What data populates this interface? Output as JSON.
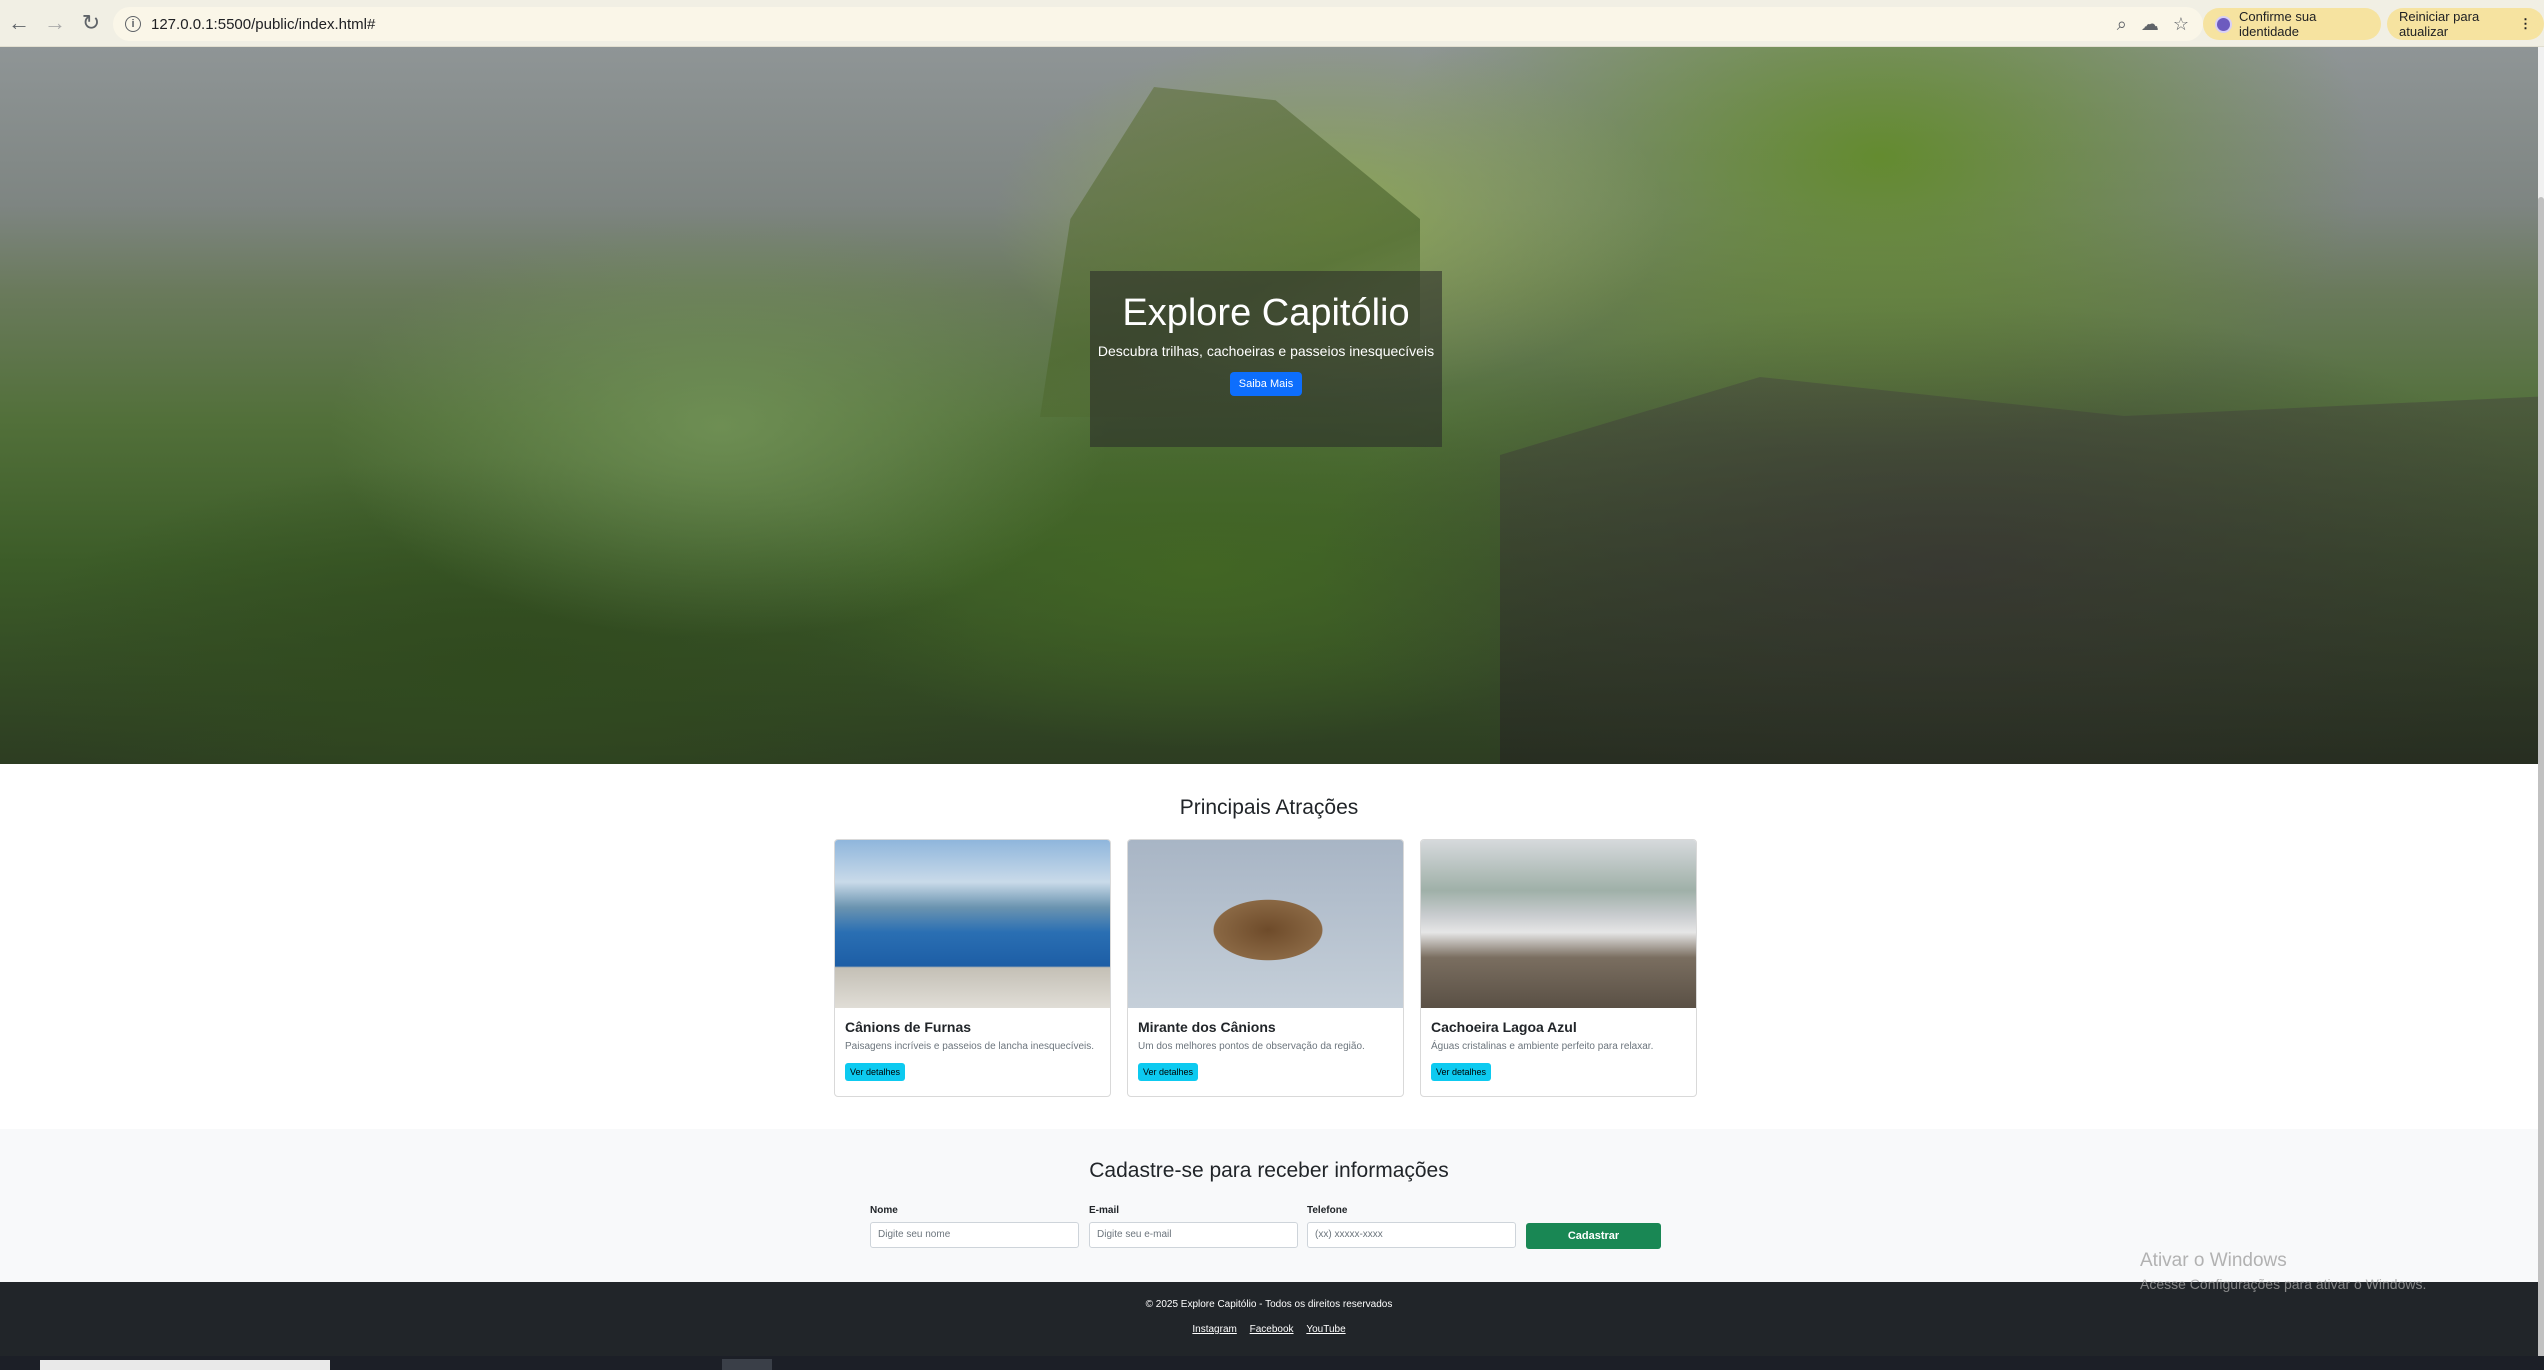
{
  "browser": {
    "url": "127.0.0.1:5500/public/index.html#",
    "identity_label": "Confirme sua identidade",
    "update_label": "Reiniciar para atualizar"
  },
  "hero": {
    "title": "Explore Capitólio",
    "subtitle": "Descubra trilhas, cachoeiras e passeios inesquecíveis",
    "button": "Saiba Mais"
  },
  "attractions": {
    "heading": "Principais Atrações",
    "cards": [
      {
        "title": "Cânions de Furnas",
        "text": "Paisagens incríveis e passeios de lancha inesquecíveis.",
        "button": "Ver detalhes"
      },
      {
        "title": "Mirante dos Cânions",
        "text": "Um dos melhores pontos de observação da região.",
        "button": "Ver detalhes"
      },
      {
        "title": "Cachoeira Lagoa Azul",
        "text": "Águas cristalinas e ambiente perfeito para relaxar.",
        "button": "Ver detalhes"
      }
    ]
  },
  "signup": {
    "heading": "Cadastre-se para receber informações",
    "name_label": "Nome",
    "name_placeholder": "Digite seu nome",
    "email_label": "E-mail",
    "email_placeholder": "Digite seu e-mail",
    "phone_label": "Telefone",
    "phone_placeholder": "(xx) xxxxx-xxxx",
    "submit": "Cadastrar"
  },
  "footer": {
    "copyright": "© 2025 Explore Capitólio - Todos os direitos reservados",
    "links": [
      "Instagram",
      "Facebook",
      "YouTube"
    ]
  },
  "watermark": {
    "title": "Ativar o Windows",
    "text": "Acesse Configurações para ativar o Windows."
  },
  "colors": {
    "primary": "#0d6efd",
    "info": "#0dcaf0",
    "success": "#198754",
    "footer_bg": "#212529"
  }
}
